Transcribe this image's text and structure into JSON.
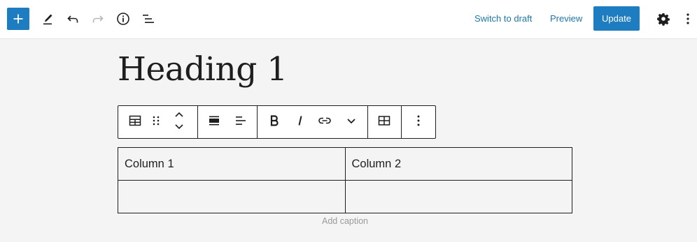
{
  "toolbar": {
    "add_block_icon": "plus-icon",
    "edit_icon": "pencil-icon",
    "undo_icon": "undo-icon",
    "redo_icon": "redo-icon",
    "info_icon": "info-icon",
    "list_view_icon": "list-view-icon",
    "switch_to_draft_label": "Switch to draft",
    "preview_label": "Preview",
    "update_label": "Update",
    "settings_icon": "gear-icon",
    "options_icon": "more-vertical-icon"
  },
  "editor": {
    "heading": "Heading 1"
  },
  "block_toolbar": {
    "items": [
      "table-icon",
      "drag-handle-icon",
      "move-up-down-icon",
      "align-full-icon",
      "align-left-icon",
      "bold-icon",
      "italic-icon",
      "link-icon",
      "chevron-down-icon",
      "edit-table-icon",
      "more-vertical-icon"
    ]
  },
  "table": {
    "header": [
      "Column 1",
      "Column 2"
    ],
    "rows": [
      [
        "",
        ""
      ]
    ],
    "caption_placeholder": "Add caption"
  },
  "colors": {
    "accent": "#1e7cc0",
    "link": "#1e76a8",
    "canvas_bg": "#f4f4f4",
    "text": "#1e1e1e"
  }
}
